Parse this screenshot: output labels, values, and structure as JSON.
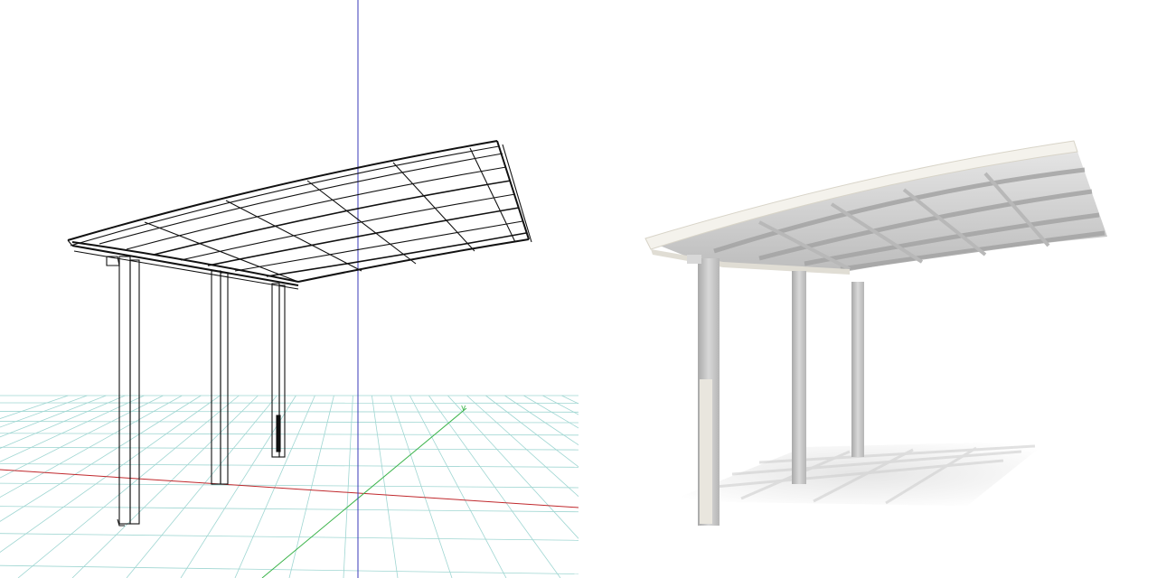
{
  "scene": {
    "panels": [
      {
        "name": "wireframe-view",
        "style": "wireframe",
        "grid": "on",
        "axes": [
          "x-axis-red",
          "y-axis-green",
          "z-axis-blue"
        ]
      },
      {
        "name": "rendered-view",
        "style": "shaded",
        "grid": "off"
      }
    ],
    "model": "carport",
    "post_count": 3,
    "colors": {
      "wire_line": "#111111",
      "grid_line": "#9fd6d2",
      "x_axis": "#c0282c",
      "y_axis": "#3cb44b",
      "z_axis": "#3a3ab8",
      "roof_frame": "#f4f2ec",
      "roof_panel": "#c9c9c9",
      "post": "#bdbdbd",
      "shadow": "#e9e9e9"
    }
  }
}
